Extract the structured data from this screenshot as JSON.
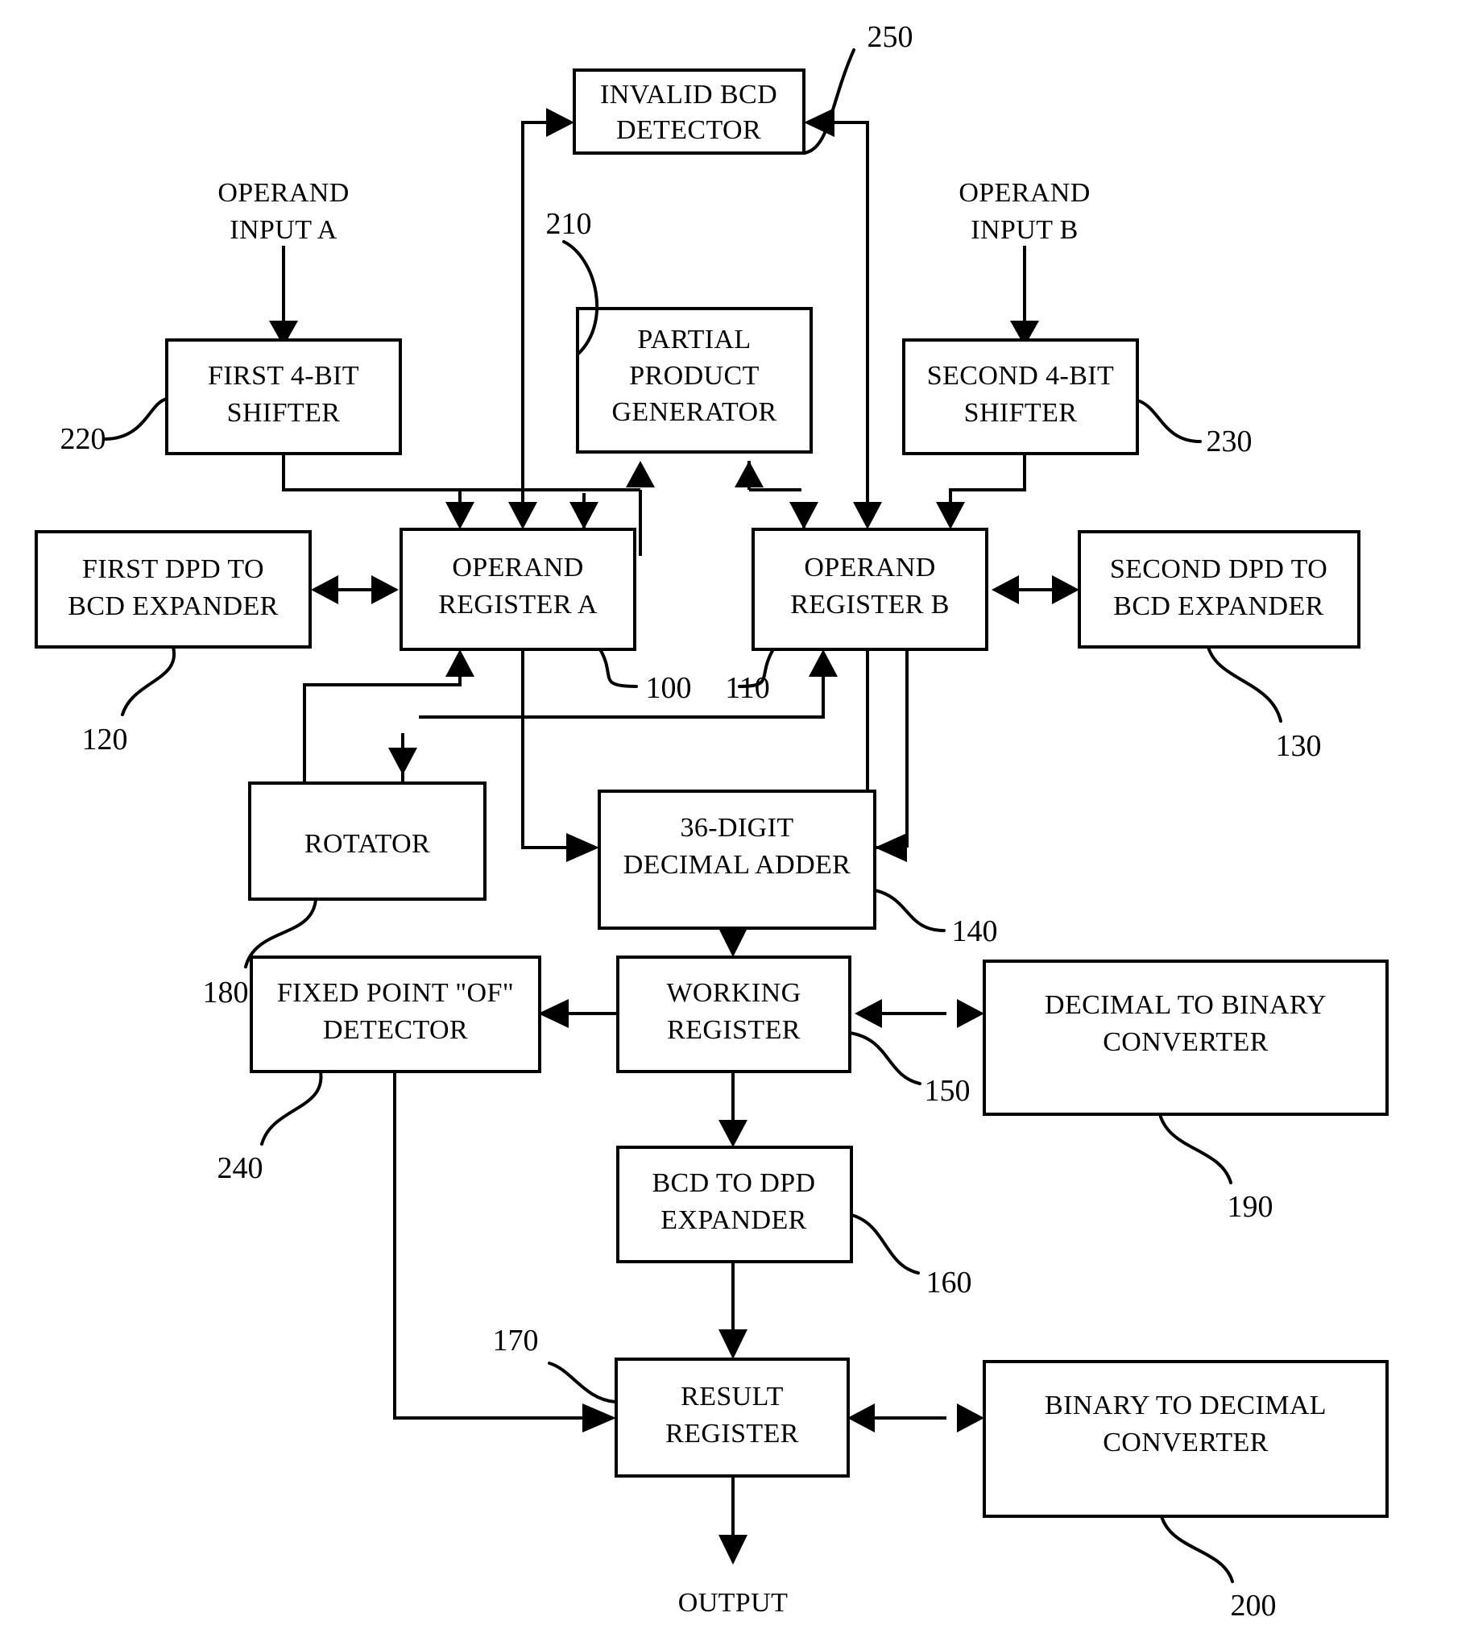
{
  "figure": {
    "type": "block-diagram",
    "title": "",
    "background": "#ffffff",
    "line_color": "#000000"
  },
  "free_labels": [
    {
      "id": "operand-input-a",
      "lines": [
        "OPERAND",
        "INPUT A"
      ]
    },
    {
      "id": "operand-input-b",
      "lines": [
        "OPERAND",
        "INPUT B"
      ]
    },
    {
      "id": "output",
      "lines": [
        "OUTPUT"
      ]
    }
  ],
  "blocks": {
    "invalid_bcd_detector": {
      "lines": [
        "INVALID BCD",
        "DETECTOR"
      ],
      "ref": "250"
    },
    "partial_product_generator": {
      "lines": [
        "PARTIAL",
        "PRODUCT",
        "GENERATOR"
      ],
      "ref": "210"
    },
    "first_4bit_shifter": {
      "lines": [
        "FIRST 4-BIT",
        "SHIFTER"
      ],
      "ref": "220"
    },
    "second_4bit_shifter": {
      "lines": [
        "SECOND 4-BIT",
        "SHIFTER"
      ],
      "ref": "230"
    },
    "first_dpd_to_bcd_expander": {
      "lines": [
        "FIRST DPD TO",
        "BCD EXPANDER"
      ],
      "ref": "120"
    },
    "operand_register_a": {
      "lines": [
        "OPERAND",
        "REGISTER A"
      ],
      "ref": "100"
    },
    "operand_register_b": {
      "lines": [
        "OPERAND",
        "REGISTER B"
      ],
      "ref": "110"
    },
    "second_dpd_to_bcd_expander": {
      "lines": [
        "SECOND DPD TO",
        "BCD EXPANDER"
      ],
      "ref": "130"
    },
    "rotator": {
      "lines": [
        "ROTATOR"
      ],
      "ref": "180"
    },
    "decimal_adder": {
      "lines": [
        "36-DIGIT",
        "DECIMAL ADDER"
      ],
      "ref": "140"
    },
    "fixed_point_of_detector": {
      "lines": [
        "FIXED POINT \"OF\"",
        "DETECTOR"
      ],
      "ref": "240"
    },
    "working_register": {
      "lines": [
        "WORKING",
        "REGISTER"
      ],
      "ref": "150"
    },
    "decimal_to_binary_converter": {
      "lines": [
        "DECIMAL TO BINARY",
        "CONVERTER"
      ],
      "ref": "190"
    },
    "bcd_to_dpd_expander": {
      "lines": [
        "BCD TO DPD",
        "EXPANDER"
      ],
      "ref": "160"
    },
    "result_register": {
      "lines": [
        "RESULT",
        "REGISTER"
      ],
      "ref": "170"
    },
    "binary_to_decimal_converter": {
      "lines": [
        "BINARY TO DECIMAL",
        "CONVERTER"
      ],
      "ref": "200"
    }
  },
  "reference_numerals": [
    "100",
    "110",
    "120",
    "130",
    "140",
    "150",
    "160",
    "170",
    "180",
    "190",
    "200",
    "210",
    "220",
    "230",
    "240",
    "250"
  ]
}
